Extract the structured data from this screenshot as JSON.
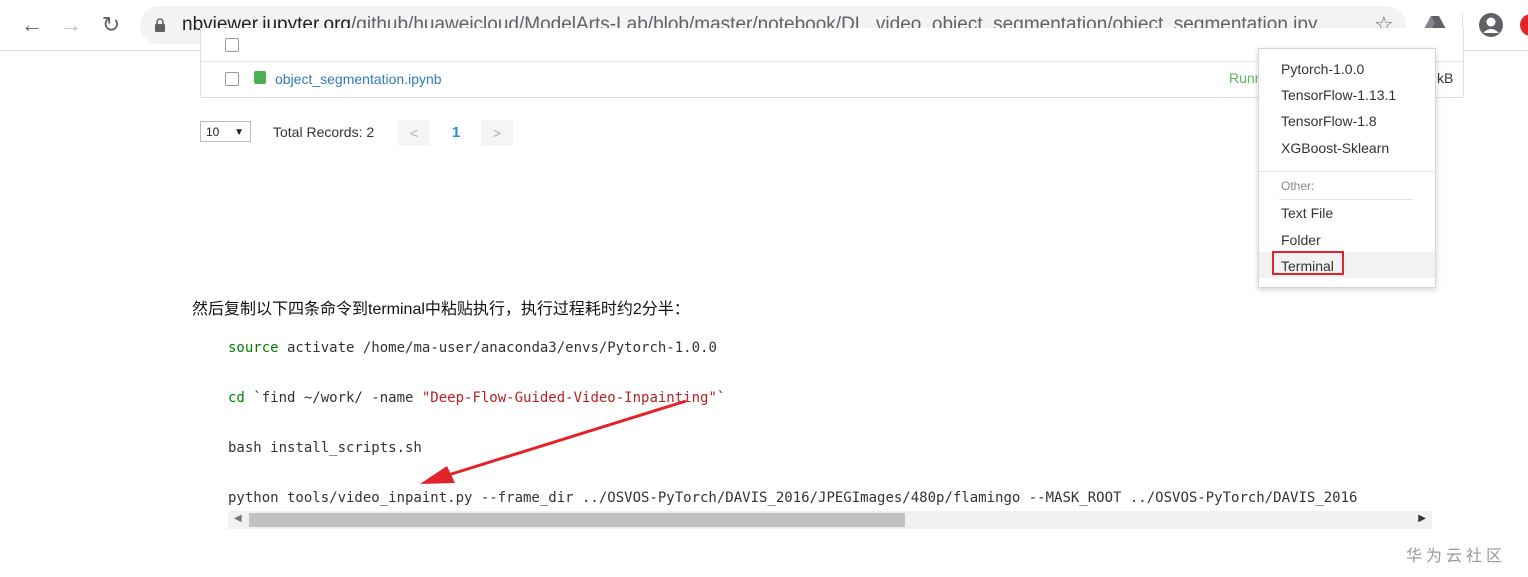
{
  "browser": {
    "url_host": "nbviewer.jupyter.org",
    "url_path": "/github/huaweicloud/ModelArts-Lab/blob/master/notebook/DL_video_object_segmentation/object_segmentation.ipy...",
    "back_glyph": "←",
    "forward_glyph": "→",
    "reload_glyph": "↻",
    "star_glyph": "☆"
  },
  "file_list": {
    "filename": "object_segmentation.ipynb",
    "status_text": "Runni",
    "size_text": "kB"
  },
  "pagination": {
    "page_size": "10",
    "total_records": "Total Records: 2",
    "prev": "<",
    "current": "1",
    "next": ">"
  },
  "menu": {
    "kernels": [
      "Pytorch-1.0.0",
      "TensorFlow-1.13.1",
      "TensorFlow-1.8",
      "XGBoost-Sklearn"
    ],
    "other_header": "Other:",
    "other_items": [
      "Text File",
      "Folder",
      "Terminal"
    ]
  },
  "notebook": {
    "instruction": "然后复制以下四条命令到terminal中粘贴执行，执行过程耗时约2分半：",
    "cmd1_keyword": "source",
    "cmd1_rest": " activate /home/ma-user/anaconda3/envs/Pytorch-1.0.0",
    "cmd2_keyword": "cd",
    "cmd2_mid": " `find ~/work/ -name ",
    "cmd2_string": "\"Deep-Flow-Guided-Video-Inpainting\"",
    "cmd2_end": "`",
    "cmd3": "bash install_scripts.sh",
    "cmd4": "python tools/video_inpaint.py --frame_dir ../OSVOS-PyTorch/DAVIS_2016/JPEGImages/480p/flamingo --MASK_ROOT ../OSVOS-PyTorch/DAVIS_2016"
  },
  "watermark": "华为云社区",
  "colors": {
    "highlight": "#e2232a",
    "link": "#337ab7",
    "running": "#5cb85c",
    "code_keyword": "#008000",
    "code_string": "#ba2121"
  }
}
